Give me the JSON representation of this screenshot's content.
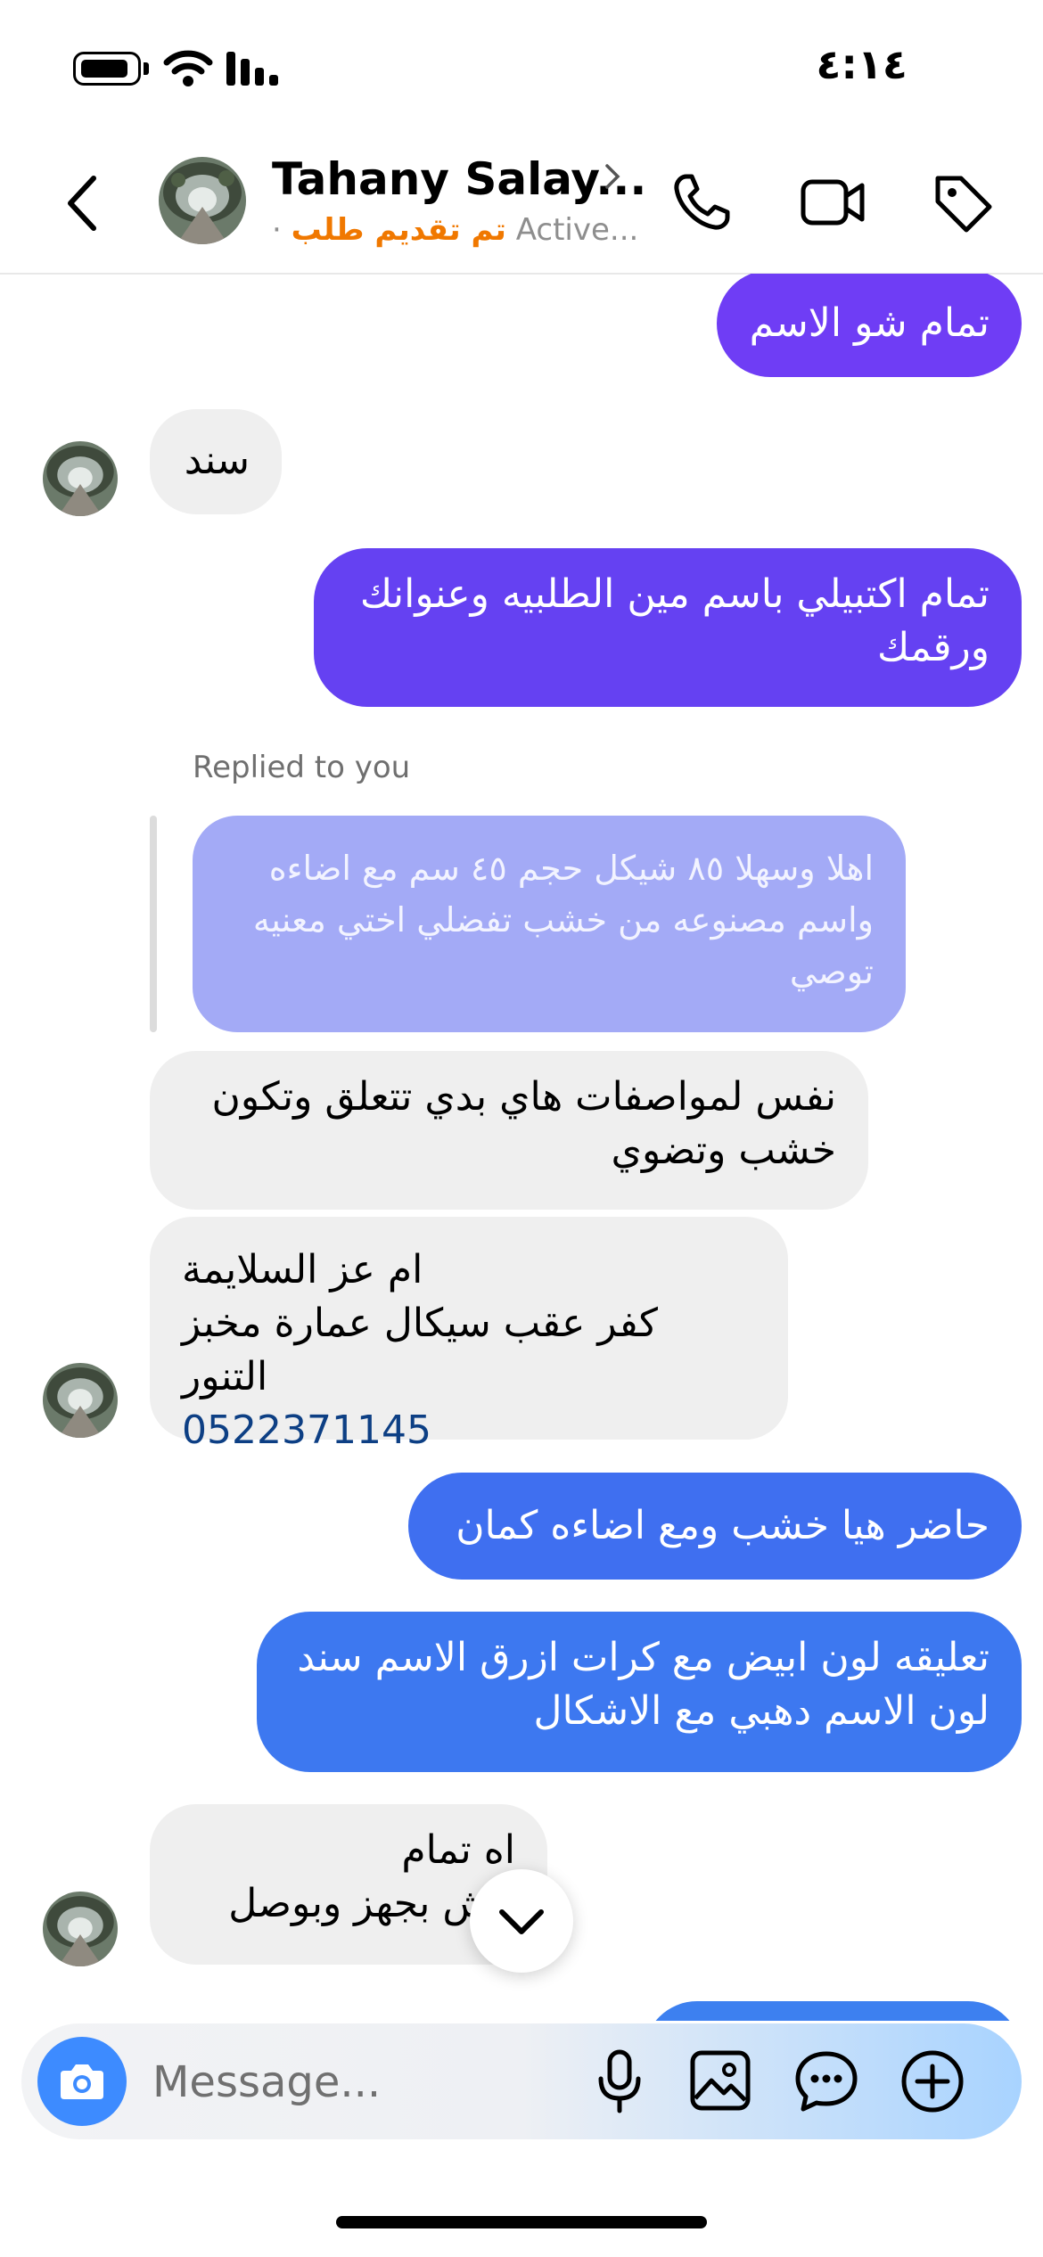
{
  "status_bar": {
    "time": "٤:١٤"
  },
  "header": {
    "name": "Tahany Salay...",
    "status_label": "تم تقديم طلب",
    "activity": "Active...",
    "separator": "·"
  },
  "messages": [
    {
      "id": "m1",
      "direction": "outgoing",
      "text": "تمام شو الاسم",
      "color": "#6f3df5"
    },
    {
      "id": "m2",
      "direction": "incoming",
      "text": "سند"
    },
    {
      "id": "m3",
      "direction": "outgoing",
      "lines": [
        "تمام اكتبيلي باسم مين الطلبيه وعنوانك",
        "ورقمك"
      ],
      "color": "#6541f2"
    },
    {
      "id": "m4",
      "direction": "incoming",
      "replied_label": "Replied to you",
      "quoted_lines": [
        "اهلا وسهلا ٨٥ شيكل حجم ٤٥ سم مع اضاءه",
        "واسم مصنوعه من خشب تفضلي اختي معنيه",
        "توصي"
      ]
    },
    {
      "id": "m5",
      "direction": "incoming",
      "lines": [
        "نفس لمواصفات هاي بدي تتعلق وتكون",
        "خشب وتضوي"
      ]
    },
    {
      "id": "m6",
      "direction": "incoming",
      "lines": [
        "ام عز السلايمة",
        "كفر عقب سيكال عمارة مخبز التنور"
      ],
      "phone": "0522371145"
    },
    {
      "id": "m7",
      "direction": "outgoing",
      "text": "حاضر هيا خشب ومع اضاءه كمان",
      "color": "#3f6ff0"
    },
    {
      "id": "m8",
      "direction": "outgoing",
      "lines": [
        "تعليقه لون ابيض مع كرات ازرق الاسم سند",
        "لون الاسم دهبي مع الاشكال"
      ],
      "color": "#3d78f0"
    },
    {
      "id": "m9",
      "direction": "incoming",
      "lines": [
        "اه تمام",
        "نيش بجهز وبوصل"
      ]
    }
  ],
  "composer": {
    "placeholder": "Message..."
  },
  "colors": {
    "accent_orange": "#f07800",
    "link_blue": "#0d3f84",
    "camera_blue": "#3d8bff"
  },
  "icons": [
    "battery-icon",
    "wifi-icon",
    "signal-icon",
    "back-chevron-icon",
    "chevron-right-icon",
    "phone-icon",
    "video-icon",
    "tag-icon",
    "chevron-down-icon",
    "camera-icon",
    "microphone-icon",
    "image-icon",
    "sticker-chat-icon",
    "plus-circle-icon"
  ]
}
